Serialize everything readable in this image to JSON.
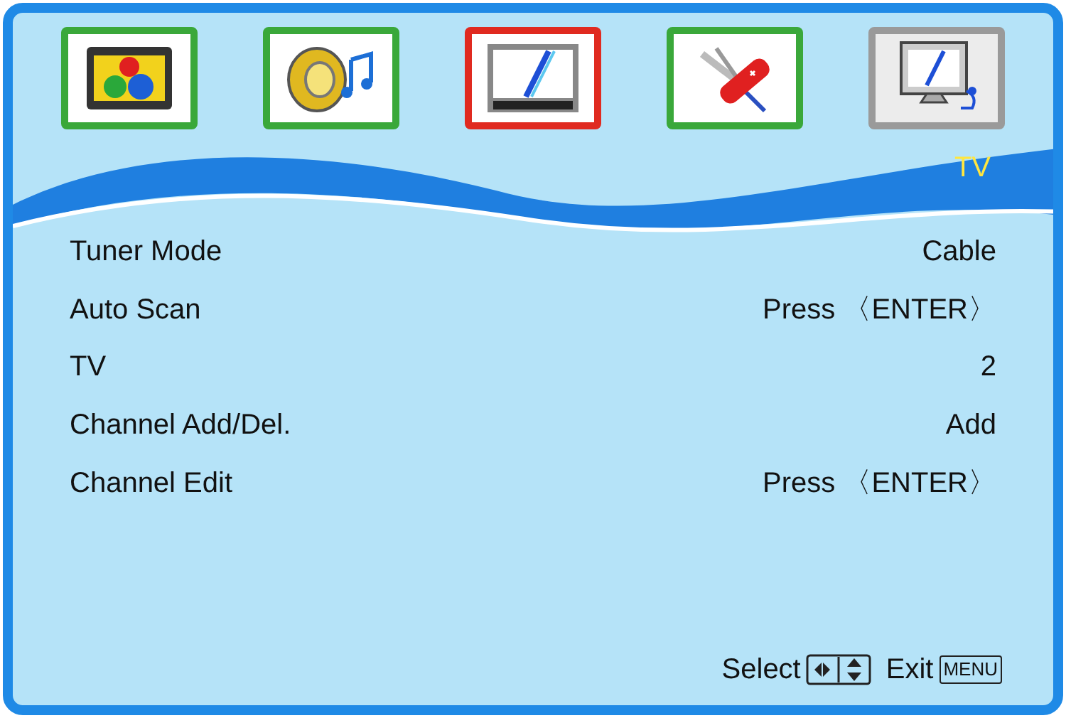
{
  "tabs": [
    {
      "kind": "picture",
      "selected": false,
      "focused": false
    },
    {
      "kind": "sound",
      "selected": false,
      "focused": false
    },
    {
      "kind": "screen",
      "selected": false,
      "focused": true
    },
    {
      "kind": "tools",
      "selected": false,
      "focused": false
    },
    {
      "kind": "tv",
      "selected": true,
      "focused": false
    }
  ],
  "page_title": "TV",
  "settings": [
    {
      "label": "Tuner Mode",
      "value": "Cable"
    },
    {
      "label": "Auto Scan",
      "value": "Press 〈ENTER〉"
    },
    {
      "label": "TV",
      "value": "2"
    },
    {
      "label": "Channel Add/Del.",
      "value": "Add"
    },
    {
      "label": "Channel Edit",
      "value": "Press 〈ENTER〉"
    }
  ],
  "footer": {
    "select_label": "Select",
    "exit_label": "Exit",
    "exit_key": "MENU"
  }
}
